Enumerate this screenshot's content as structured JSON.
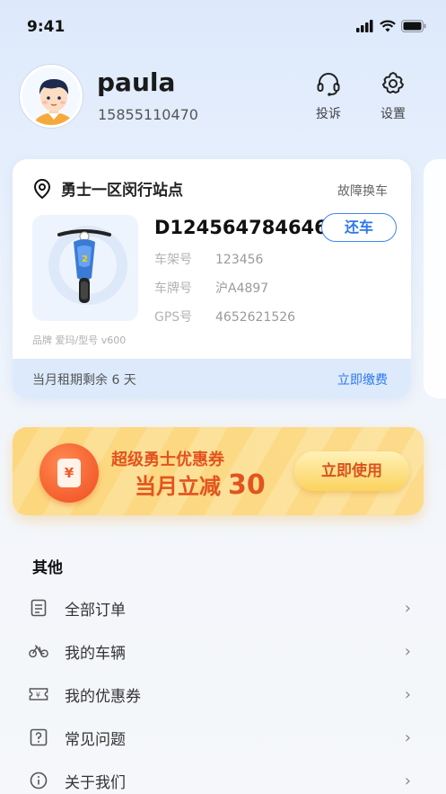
{
  "status_bar": {
    "time": "9:41"
  },
  "user": {
    "name": "paula",
    "phone": "15855110470"
  },
  "header_actions": {
    "complaint_label": "投诉",
    "settings_label": "设置"
  },
  "rental_card": {
    "station": "勇士一区闵行站点",
    "fault_swap": "故障换车",
    "vehicle_id": "D124564784646",
    "return_label": "还车",
    "specs": [
      {
        "key": "车架号",
        "value": "123456"
      },
      {
        "key": "车牌号",
        "value": "沪A4897"
      },
      {
        "key": "GPS号",
        "value": "4652621526"
      }
    ],
    "brand_model": "品牌 爱玛/型号 v600",
    "rent_remaining": "当月租期剩余 6 天",
    "pay_now": "立即缴费"
  },
  "coupon": {
    "title": "超级勇士优惠券",
    "subtitle": "当月立减",
    "amount": "30",
    "use_label": "立即使用",
    "icon_glyph": "¥"
  },
  "other_section": {
    "title": "其他",
    "items": [
      {
        "label": "全部订单",
        "icon": "order-list-icon"
      },
      {
        "label": "我的车辆",
        "icon": "bicycle-icon"
      },
      {
        "label": "我的优惠券",
        "icon": "coupon-ticket-icon"
      },
      {
        "label": "常见问题",
        "icon": "question-icon"
      },
      {
        "label": "关于我们",
        "icon": "info-icon"
      }
    ],
    "chevron": "›"
  },
  "colors": {
    "accent": "#2d78ee",
    "coupon_text": "#e2531f",
    "coupon_bg": "#fbd77f"
  }
}
